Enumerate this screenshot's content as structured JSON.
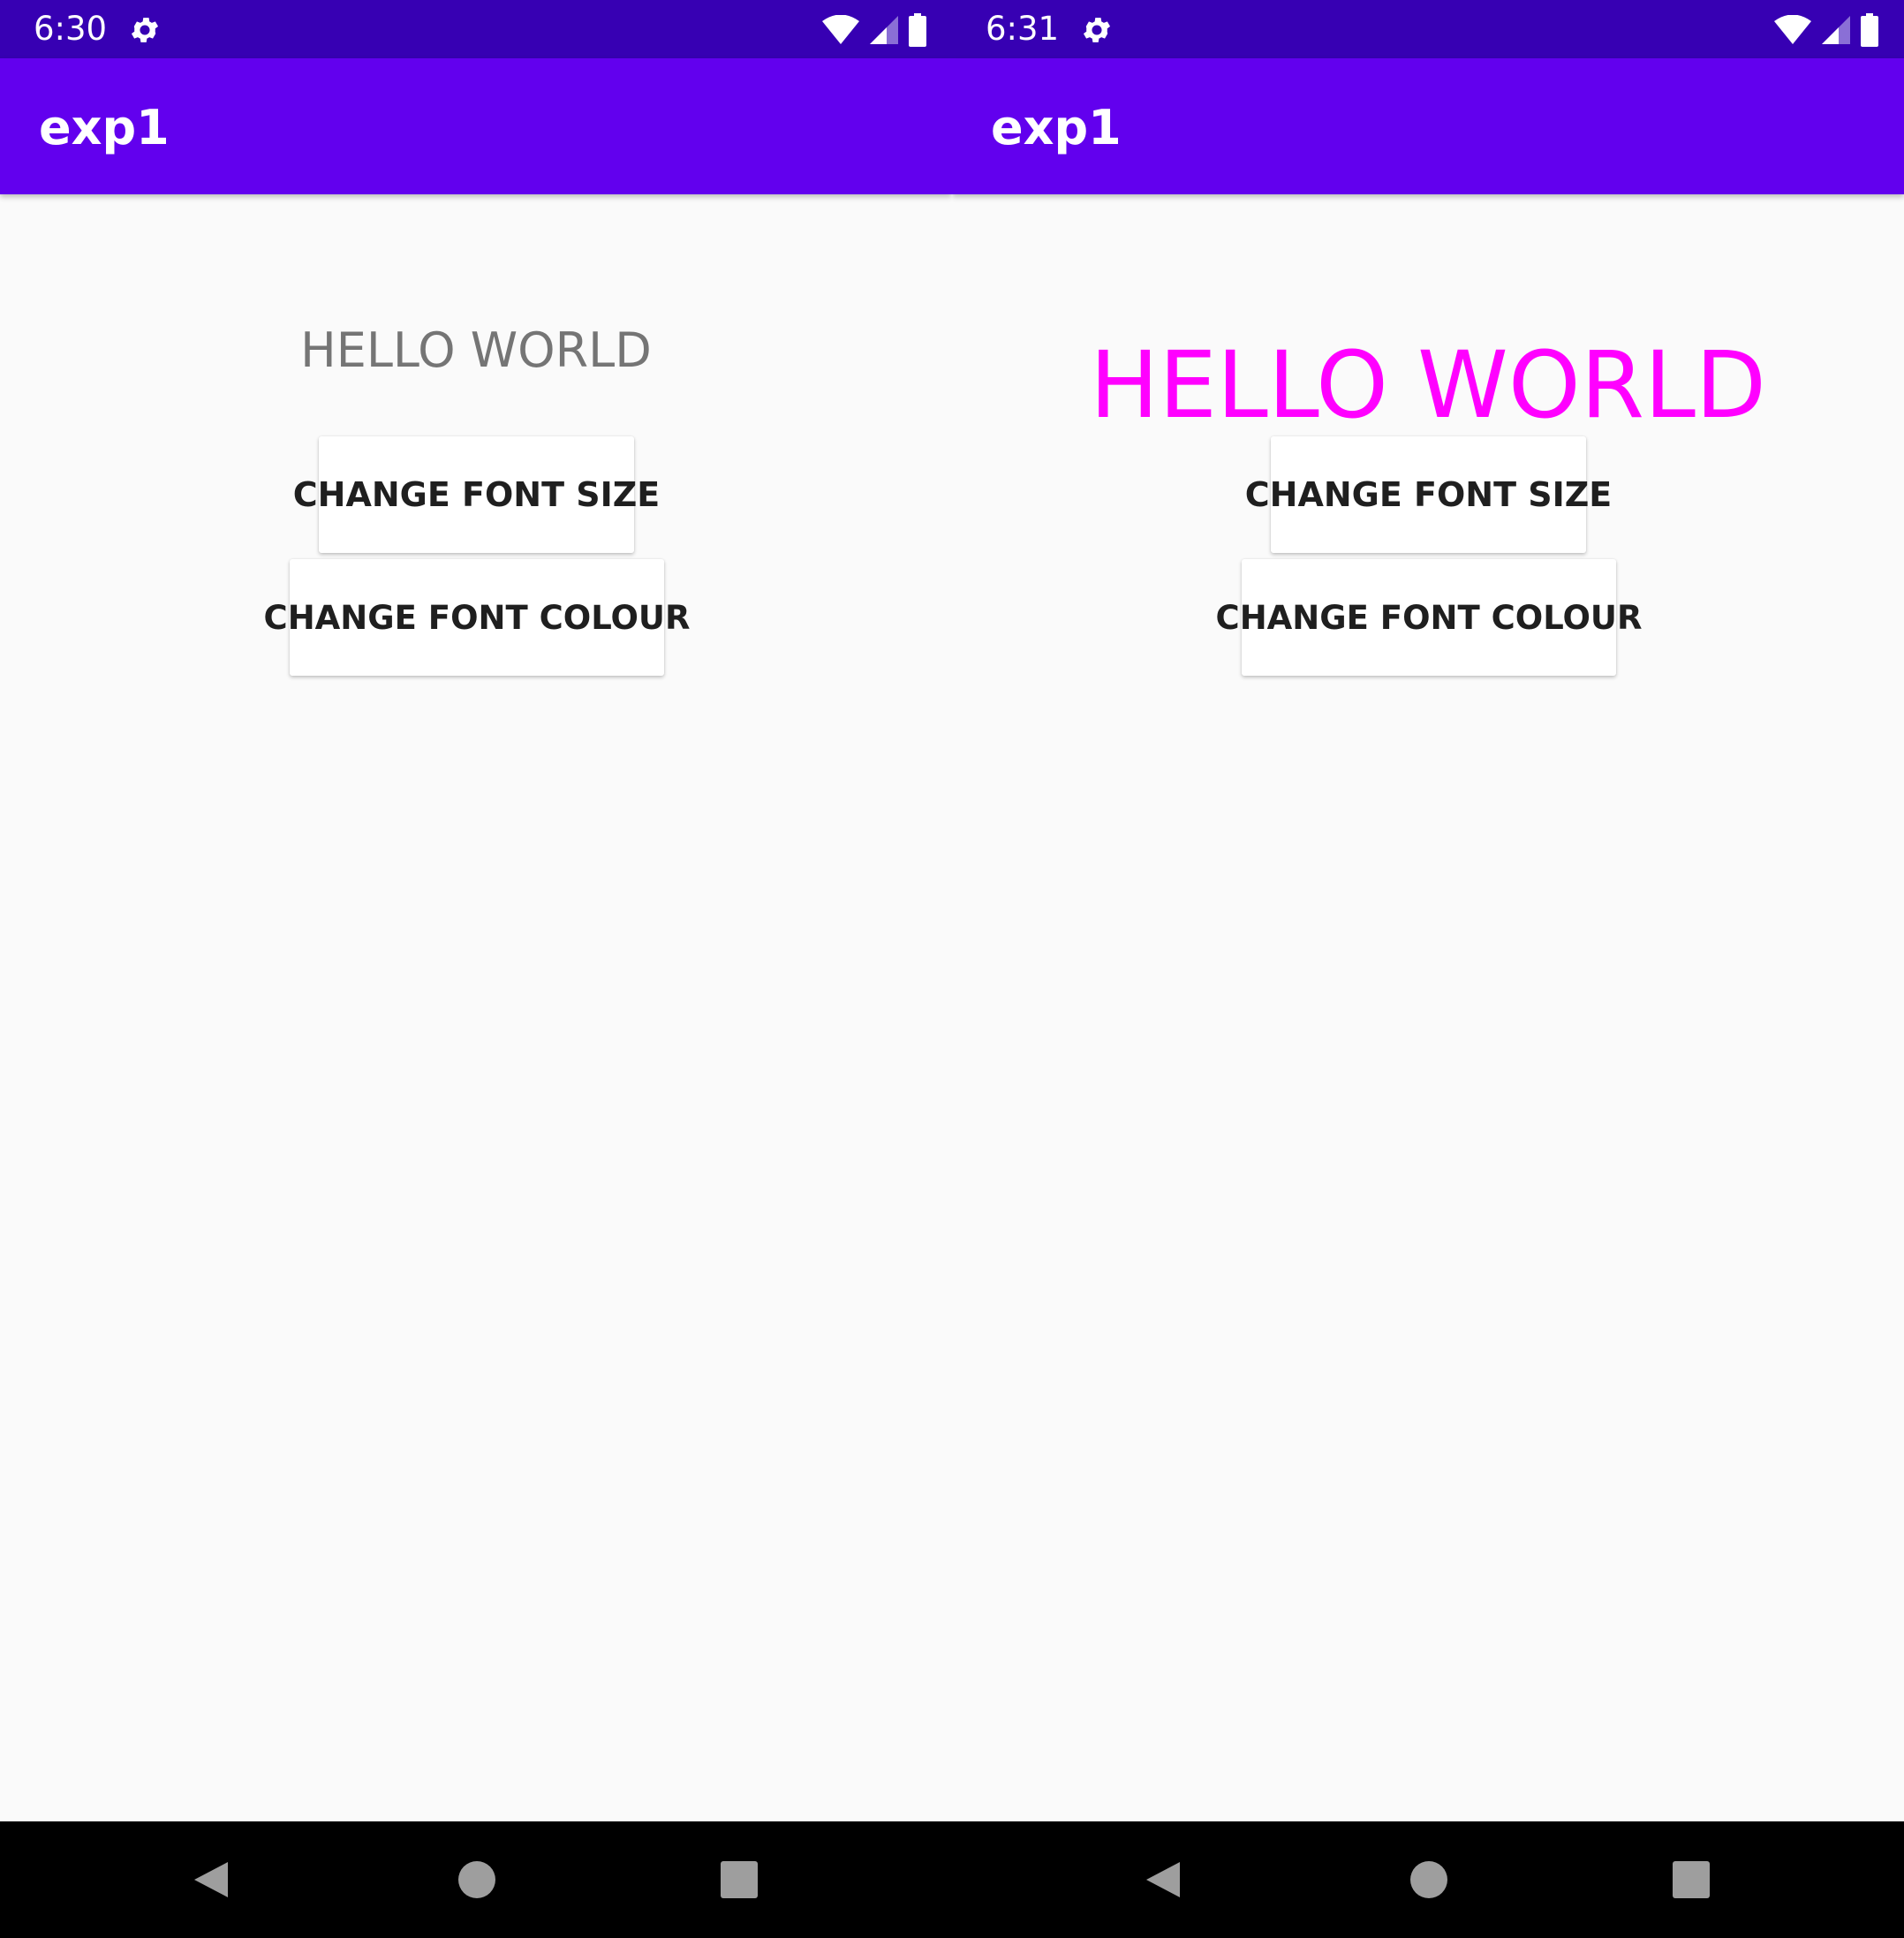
{
  "screens": [
    {
      "status": {
        "time": "6:30"
      },
      "app_title": "exp1",
      "hello_text": "HELLO WORLD",
      "hello_color": "#757575",
      "buttons": {
        "size_label": "CHANGE FONT SIZE",
        "colour_label": "CHANGE FONT COLOUR"
      }
    },
    {
      "status": {
        "time": "6:31"
      },
      "app_title": "exp1",
      "hello_text": "HELLO WORLD",
      "hello_color": "#ff00ff",
      "buttons": {
        "size_label": "CHANGE FONT SIZE",
        "colour_label": "CHANGE FONT COLOUR"
      }
    }
  ],
  "icons": {
    "status": [
      "settings-gear-icon",
      "wifi-icon",
      "signal-icon",
      "battery-icon"
    ],
    "nav": [
      "back-icon",
      "home-icon",
      "recents-icon"
    ]
  },
  "colors": {
    "status_bar": "#3700b3",
    "app_bar": "#6200ee",
    "background": "#fafafa",
    "nav_bar": "#000000"
  }
}
